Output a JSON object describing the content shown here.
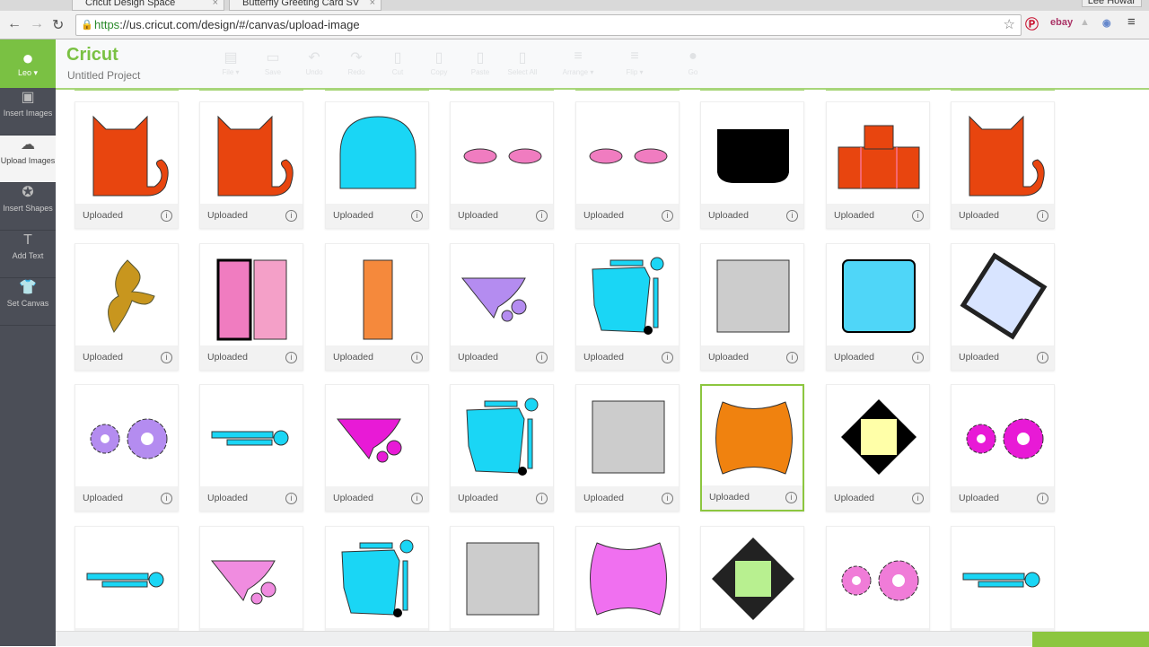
{
  "browser": {
    "tabs": [
      {
        "label": "Cricut Design Space"
      },
      {
        "label": "Butterfly Greeting Card SV"
      }
    ],
    "user": "Lee Howar",
    "url_scheme": "https",
    "url_rest": "://us.cricut.com/design/#/canvas/upload-image"
  },
  "app": {
    "logo": "Cricut",
    "project": "Untitled Project",
    "user": "Leo ▾"
  },
  "sidebar": [
    {
      "label": "Insert Images",
      "icon": "image-icon"
    },
    {
      "label": "Upload Images",
      "icon": "cloud-upload-icon",
      "active": true
    },
    {
      "label": "Insert Shapes",
      "icon": "shapes-icon"
    },
    {
      "label": "Add Text",
      "icon": "text-icon"
    },
    {
      "label": "Set Canvas",
      "icon": "shirt-icon"
    }
  ],
  "toolbar": [
    {
      "label": "File ▾",
      "icon": "▤"
    },
    {
      "label": "Save",
      "icon": "▭"
    },
    {
      "label": "Undo",
      "icon": "↶"
    },
    {
      "label": "Redo",
      "icon": "↷"
    },
    {
      "label": "Cut",
      "icon": "▯"
    },
    {
      "label": "Copy",
      "icon": "▯"
    },
    {
      "label": "Paste",
      "icon": "▯"
    },
    {
      "label": "Select All",
      "icon": "▯"
    },
    {
      "label": "Arrange ▾",
      "icon": "≡"
    },
    {
      "label": "Flip ▾",
      "icon": "≡"
    },
    {
      "label": "Go",
      "icon": "●"
    }
  ],
  "card_label": "Uploaded",
  "info_glyph": "i",
  "selected_card": 21,
  "cards": [
    "cat",
    "cat",
    "dome",
    "ovals",
    "ovals",
    "pot",
    "box",
    "cat",
    "swirl",
    "tags2",
    "tag",
    "bib-purple",
    "envelope",
    "gray-square",
    "blue-frame",
    "diamond-lace",
    "flowers-purple",
    "strips",
    "bib-magenta",
    "envelope",
    "gray-square",
    "scallop-orange",
    "diamond-yellow",
    "flowers-magenta",
    "strips",
    "bib-pink",
    "envelope",
    "gray-square",
    "scallop-pink",
    "diamond-green",
    "flowers-pink",
    "strips"
  ],
  "colors": {
    "accent": "#7ac143",
    "sidebar": "#4b4e57",
    "orange_red": "#e8450f",
    "cyan": "#1ad6f5",
    "pink": "#f07cc0",
    "purple": "#b48cf0",
    "magenta": "#e81ad6",
    "orange": "#f0820f"
  }
}
